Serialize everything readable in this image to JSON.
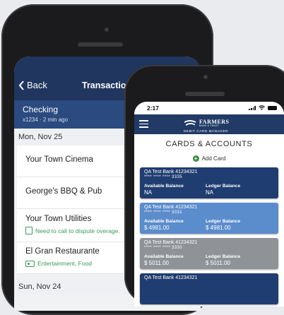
{
  "back_app": {
    "nav": {
      "back_label": "Back",
      "title": "Transactions"
    },
    "account": {
      "name": "Checking",
      "subtitle": "x1234 · 2 min ago"
    },
    "groups": [
      {
        "date": "Mon, Nov 25",
        "items": [
          {
            "name": "Your Town Cinema"
          },
          {
            "name": "George's BBQ & Pub"
          },
          {
            "name": "Your Town Utilities",
            "sub": "Need to call to dispute overage."
          },
          {
            "name": "El Gran Restaurante",
            "sub": "Entertainment, Food"
          }
        ]
      },
      {
        "date": "Sun, Nov 24"
      }
    ]
  },
  "front_app": {
    "status": {
      "time": "2:17"
    },
    "brand": {
      "name": "FARMERS",
      "tag": "BANK & TRUST",
      "sub": "DEBIT CARD MANAGER"
    },
    "section_title": "CARDS & ACCOUNTS",
    "add_card_label": "Add Card",
    "cards": [
      {
        "bank": "QA Test Bank 41234321",
        "number": "**** **** **** 3335",
        "available_label": "Available Balance",
        "available": "NA",
        "ledger_label": "Ledger Balance",
        "ledger": "NA",
        "color": "#1f3d70"
      },
      {
        "bank": "QA Test Bank 41234321",
        "number": "**** **** **** 3331",
        "available_label": "Available Balance",
        "available": "$ 4981.00",
        "ledger_label": "Ledger Balance",
        "ledger": "$ 4981.00",
        "color": "#5b8ccb"
      },
      {
        "bank": "QA Test Bank 41234321",
        "number": "**** **** **** 3330",
        "available_label": "Available Balance",
        "available": "$ 5011.00",
        "ledger_label": "Ledger Balance",
        "ledger": "$ 5011.00",
        "color": "#8f9398"
      },
      {
        "bank": "QA Test Bank 41234321",
        "color": "#1f3d70"
      }
    ]
  },
  "colors": {
    "navy": "#213a66",
    "accent_green": "#3d9a57"
  }
}
